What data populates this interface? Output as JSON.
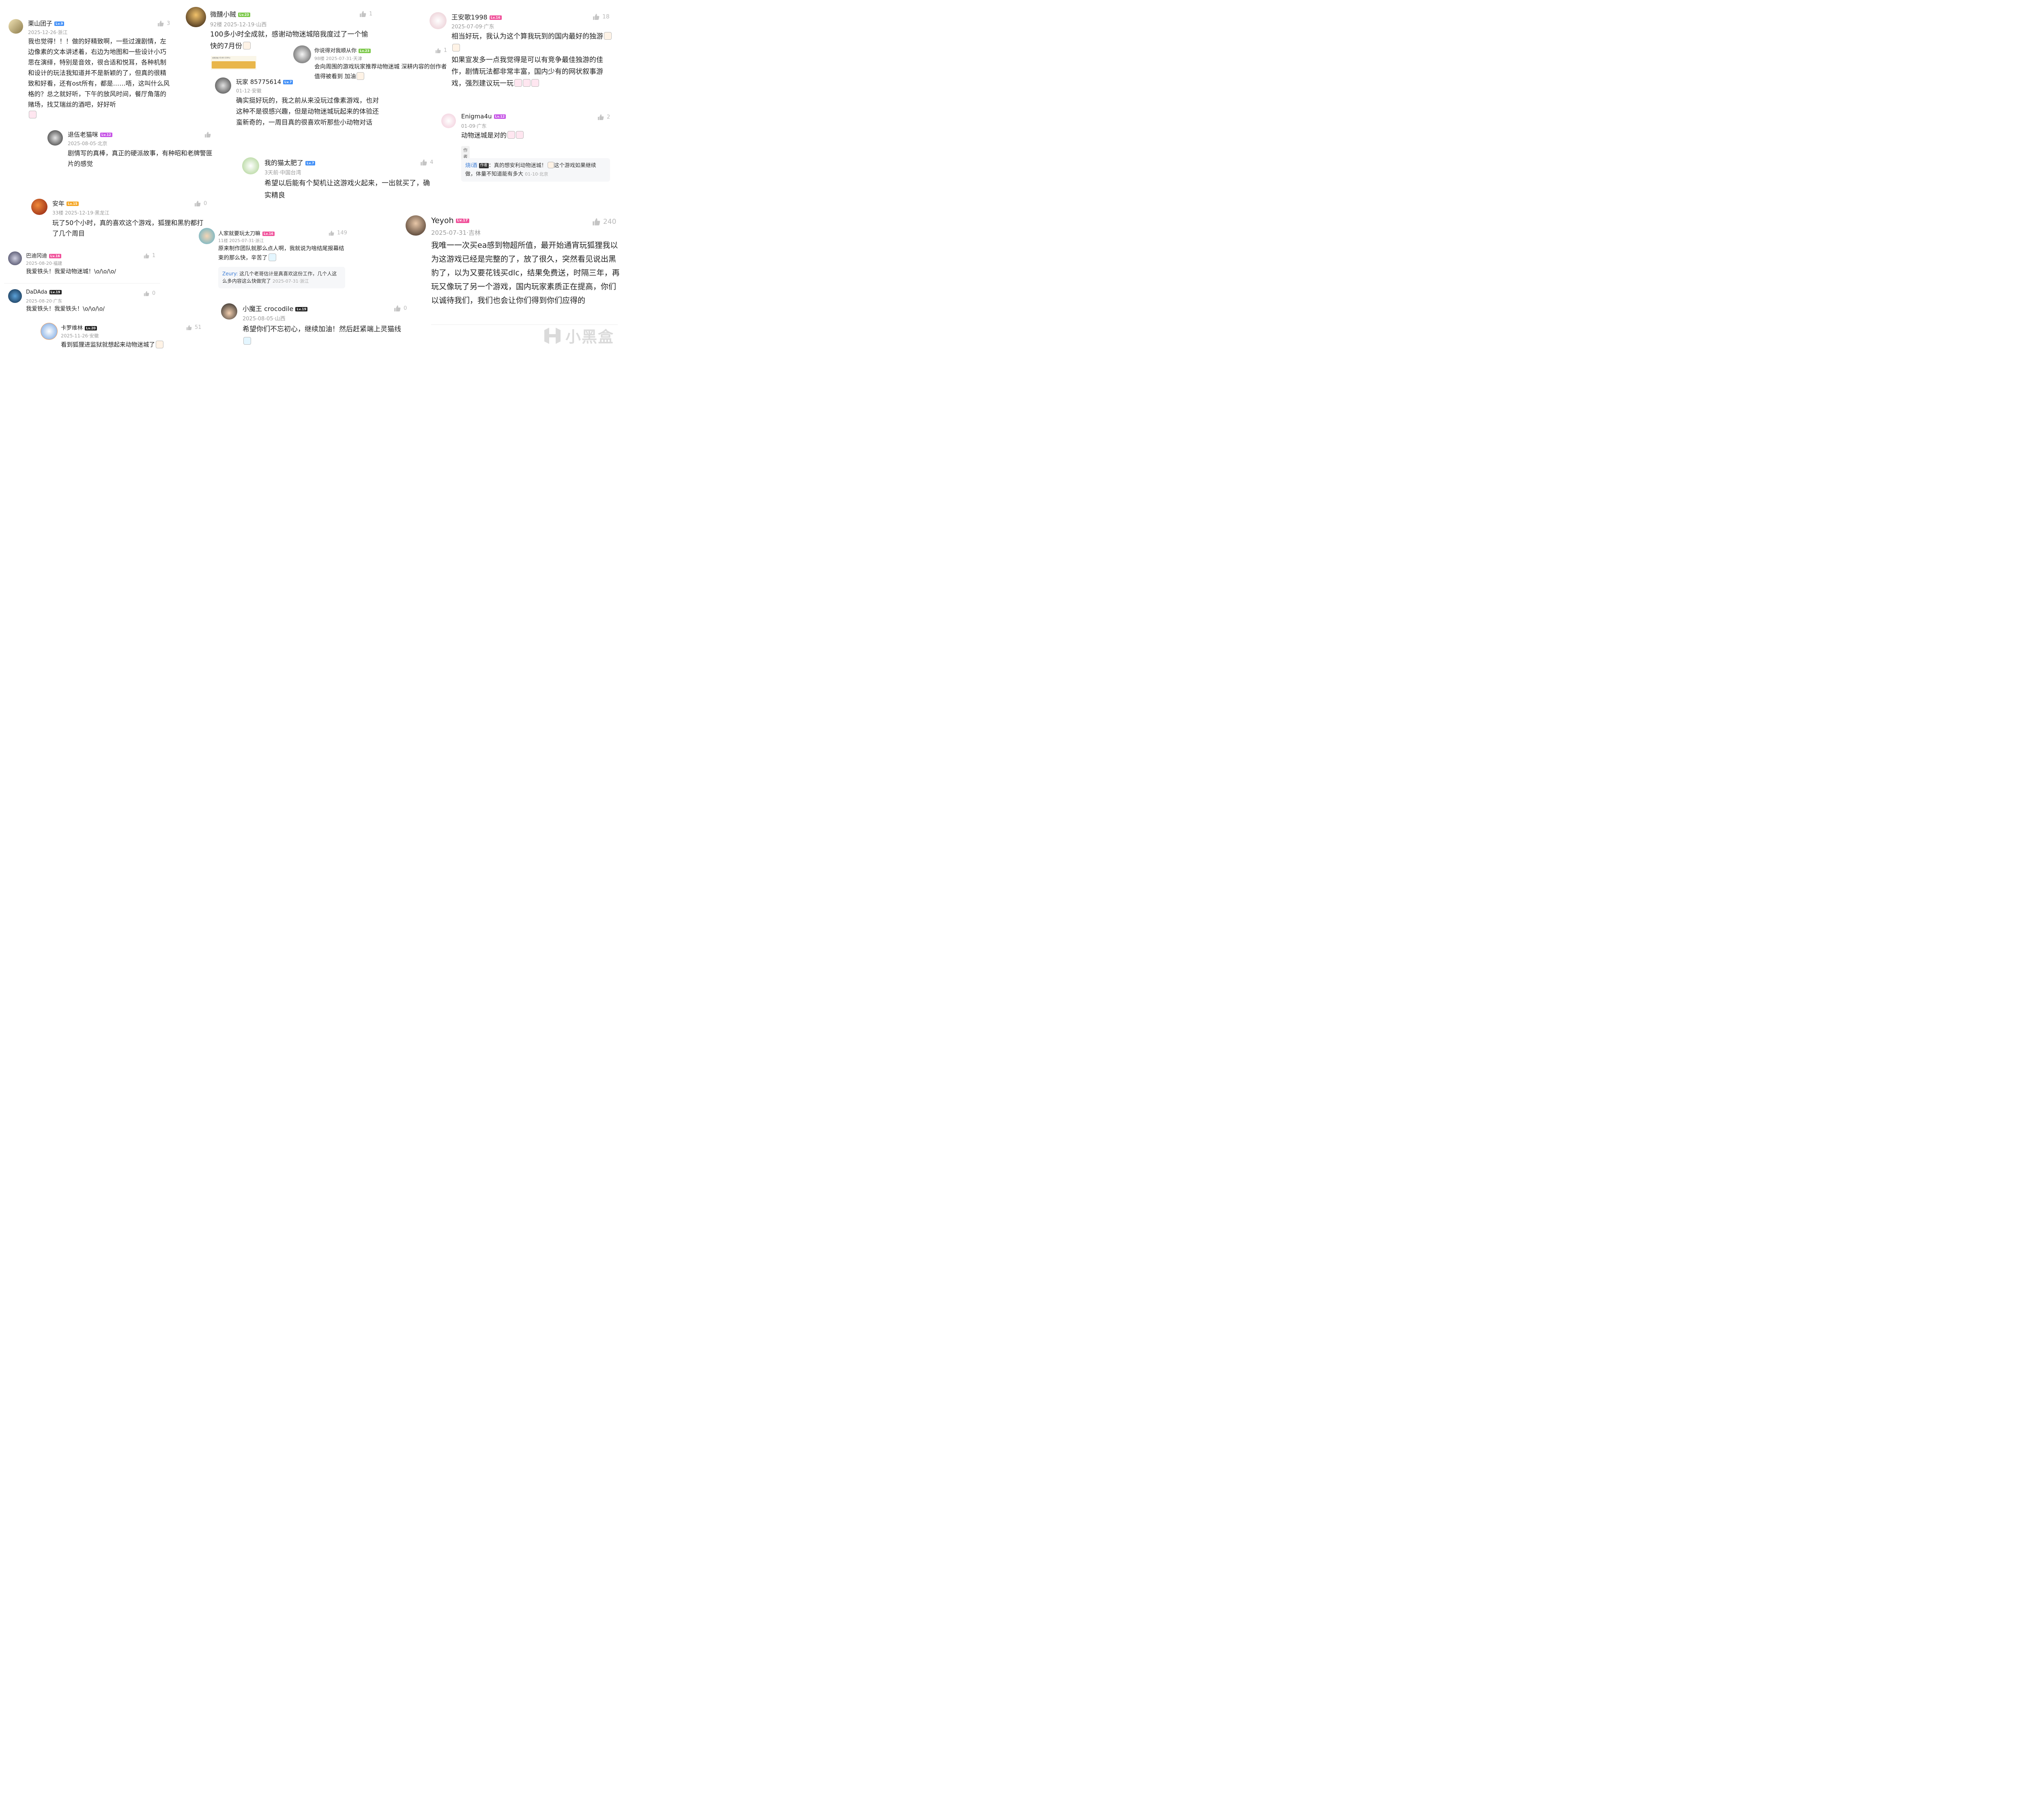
{
  "colors": {
    "lv_blue": "#3f8ef7",
    "lv_green": "#7cc94a",
    "lv_orange": "#f5a623",
    "lv_purple": "#c653e6",
    "lv_pink": "#f0509a",
    "lv_dark": "#222222",
    "reply_name": "#3a7bd5"
  },
  "comments": {
    "c1": {
      "name": "栗山团子",
      "level": "Lv.9",
      "meta": "2025-12-26·浙江",
      "likes": "3",
      "text": "我也觉得！！！做的好精致啊，一些过渡剧情，左边像素的文本讲述着，右边为地图和一些设计小巧思在演绎，特别是音效，很合适和悦耳，各种机制和设计的玩法我知道并不是新颖的了，但真的很精致和好看，还有ost所有，都是……唔，这叫什么风格的？总之就好听，下午的放风时间，餐厅角落的赌场，找艾瑞丝的酒吧，好好听"
    },
    "c2": {
      "name": "退伍老猫咪",
      "level": "Lv.12",
      "meta": "2025-08-05·北京",
      "likes": "",
      "text": "剧情写的真棒，真正的硬派故事，有种昭和老牌警匪片的感觉"
    },
    "c3": {
      "name": "安年",
      "level": "Lv.15",
      "meta": "33楼 2025-12-19·黑龙江",
      "likes": "0",
      "text": "玩了50个小时，真的喜欢这个游戏，狐狸和黑豹都打了几个周目"
    },
    "c4": {
      "name": "巴迪冈迪",
      "level": "Lv.16",
      "meta": "2025-08-20·福建",
      "likes": "1",
      "text": "我爱铁头！我爱动物迷城！\\o/\\o/\\o/"
    },
    "c5": {
      "name": "DaDAda",
      "level": "Lv.19",
      "meta": "2025-08-20·广东",
      "likes": "0",
      "text": "我爱铁头！我爱铁头！\\o/\\o/\\o/"
    },
    "c6": {
      "name": "卡罗维林",
      "level": "Lv.20",
      "meta": "2025-11-26·安徽",
      "likes": "51",
      "text": "看到狐狸进监狱就想起来动物迷城了"
    },
    "c7": {
      "name": "微醺小贼",
      "level": "Lv.23",
      "meta": "92楼 2025-12-19·山西",
      "likes": "1",
      "text": "100多小时全成就，感谢动物迷城陪我度过了一个愉快的7月份",
      "shot_title": "成就进度 45/48 (100%)"
    },
    "c8": {
      "name": "你说得对我顺从你",
      "level": "Lv.23",
      "meta": "98楼 2025-07-31·天津",
      "likes": "1",
      "text": "会向周围的游戏玩家推荐动物迷城 深耕内容的创作者值得被看到 加油"
    },
    "c9": {
      "name": "玩家 85775614",
      "level": "Lv.7",
      "meta": "01-12·安徽",
      "likes": "",
      "text": "确实挺好玩的，我之前从来没玩过像素游戏，也对这种不是很感兴趣，但是动物迷城玩起来的体验还蛮新奇的，一周目真的很喜欢听那些小动物对话"
    },
    "c10": {
      "name": "我的猫太肥了",
      "level": "Lv.7",
      "meta": "3天前·中国台湾",
      "likes": "4",
      "text": "希望以后能有个契机让这游戏火起来，一出就买了，确实精良"
    },
    "c11": {
      "name": "人家就要玩太刀嘛",
      "level": "Lv.16",
      "meta": "11楼 2025-07-31·浙江",
      "likes": "149",
      "text": "原来制作团队就那么点人啊，我就说为啥结尾报幕结束的那么快，辛苦了",
      "reply": {
        "name": "Zeury:",
        "text": "这几个老哥估计是真喜欢这份工作，几个人这么多内容这么快做完了",
        "date": "2025-07-31·浙江"
      }
    },
    "c12": {
      "name": "小魔王 crocodile",
      "level": "Lv.19",
      "meta": "2025-08-05·山西",
      "likes": "0",
      "text": "希望你们不忘初心，继续加油！然后赶紧端上灵猫线"
    },
    "c13": {
      "name": "王安歌1998",
      "level": "Lv.16",
      "meta": "2025-07-09·广东",
      "likes": "18",
      "text1": "相当好玩，我认为这个算我玩到的国内最好的独游",
      "text2": "如果宣发多一点我觉得是可以有竞争最佳独游的佳作，剧情玩法都非常丰富，国内少有的网状叙事游戏，强烈建议玩一玩"
    },
    "c14": {
      "name": "Enigma4u",
      "level": "Lv.12",
      "meta": "01-09·广东",
      "likes": "2",
      "text": "动物迷城是对的",
      "tag": "作者赞过",
      "reply": {
        "name": "烧i酒",
        "badge": "作者",
        "text": "：真的想安利动物迷城！",
        "text2": "这个游戏如果继续做，体量不知道能有多大",
        "date": "01-10·北京"
      }
    },
    "c15": {
      "name": "Yeyoh",
      "level": "Lv.17",
      "meta": "2025-07-31·吉林",
      "likes": "240",
      "text": "我唯一一次买ea感到物超所值，最开始通宵玩狐狸我以为这游戏已经是完整的了，放了很久，突然看见说出黑豹了，以为又要花钱买dlc，结果免费送，时隔三年，再玩又像玩了另一个游戏，国内玩家素质正在提高，你们以诚待我们，我们也会让你们得到你们应得的"
    }
  },
  "watermark": "小黑盒"
}
